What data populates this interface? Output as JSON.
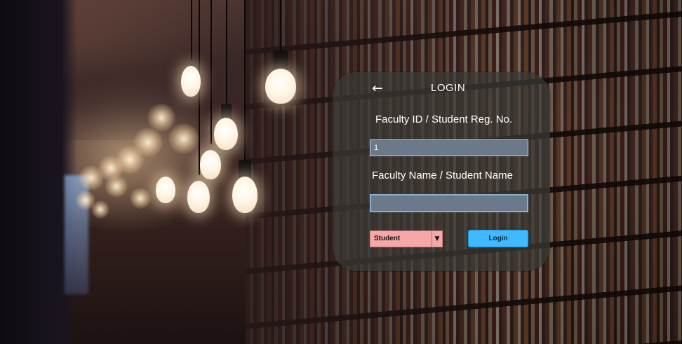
{
  "login_panel": {
    "back_icon": "arrow-left-icon",
    "back_glyph": "←",
    "title": "LOGIN",
    "id_label": "Faculty ID / Student Reg. No.",
    "id_value": "1",
    "name_label": "Faculty Name / Student Name",
    "name_value": "",
    "role_select": {
      "selected": "Student",
      "arrow_glyph": "▼",
      "arrow_icon": "dropdown-arrow-icon"
    },
    "login_button_label": "Login"
  },
  "colors": {
    "panel_bg": "#3a3a36",
    "input_bg": "#6b7a8a",
    "select_bg": "#f4a9a8",
    "login_button": "#3fb9ff"
  }
}
